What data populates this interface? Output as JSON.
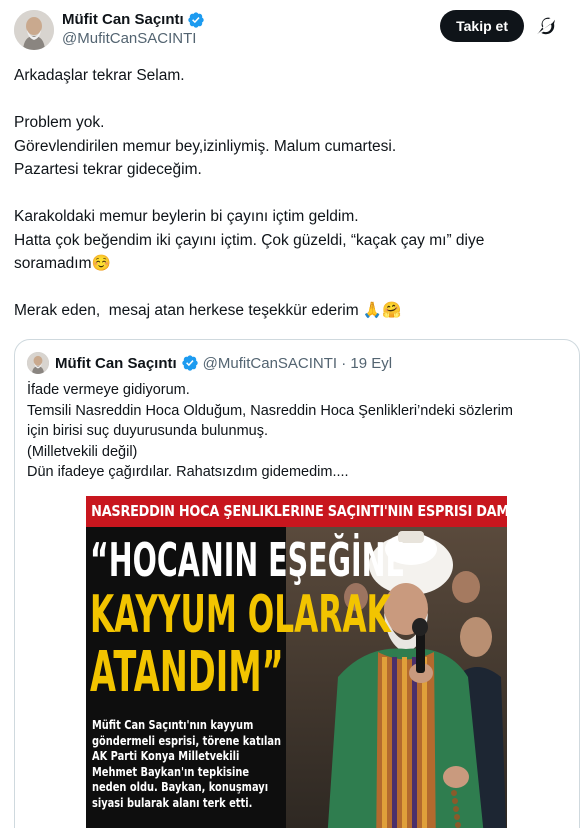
{
  "author": {
    "display_name": "Müfit Can Saçıntı",
    "handle": "@MufitCanSACINTI",
    "verified_icon": "verified-badge-icon",
    "follow_label": "Takip et",
    "more_icon": "grok-icon"
  },
  "tweet": {
    "lines": [
      "Arkadaşlar tekrar Selam.",
      "",
      "Problem yok.",
      "Görevlendirilen memur bey,izinliymiş. Malum cumartesi.",
      "Pazartesi tekrar gideceğim.",
      "",
      "Karakoldaki memur beylerin bi çayını içtim geldim.",
      "Hatta çok beğendim iki çayını içtim. Çok güzeldi, “kaçak çay mı” diye",
      "soramadım☺️",
      "",
      "Merak eden,  mesaj atan herkese teşekkür ederim 🙏🤗"
    ]
  },
  "quote": {
    "display_name": "Müfit Can Saçıntı",
    "handle_date": "@MufitCanSACINTI · 19 Eyl",
    "lines": [
      "İfade vermeye gidiyorum.",
      "Temsili Nasreddin Hoca Olduğum, Nasreddin Hoca Şenlikleri’ndeki sözlerim",
      "için birisi suç duyurusunda bulunmuş.",
      "(Milletvekili değil)",
      "Dün ifadeye çağırdılar. Rahatsızdım gidemedim...."
    ],
    "image": {
      "banner": "NASREDDIN HOCA ŞENLIKLERINE SAÇINTI'NIN ESPRISI DAMGA VURDU",
      "headline_1": "“HOCANIN EŞEĞİNE",
      "headline_2": "KAYYUM OLARAK",
      "headline_3": "ATANDIM”",
      "caption_lines": [
        "Müfit Can Saçıntı'nın kayyum",
        "göndermeli esprisi, törene katılan",
        "AK Parti Konya Milletvekili",
        "Mehmet Baykan'ın tepkisine",
        "neden oldu. Baykan, konuşmayı",
        "siyasi bularak alanı terk etti."
      ]
    }
  },
  "colors": {
    "verified": "#1d9bf0",
    "banner_red": "#c8161e",
    "headline_yellow": "#f2c400",
    "text_secondary": "#536471",
    "border": "#cfd9de"
  }
}
